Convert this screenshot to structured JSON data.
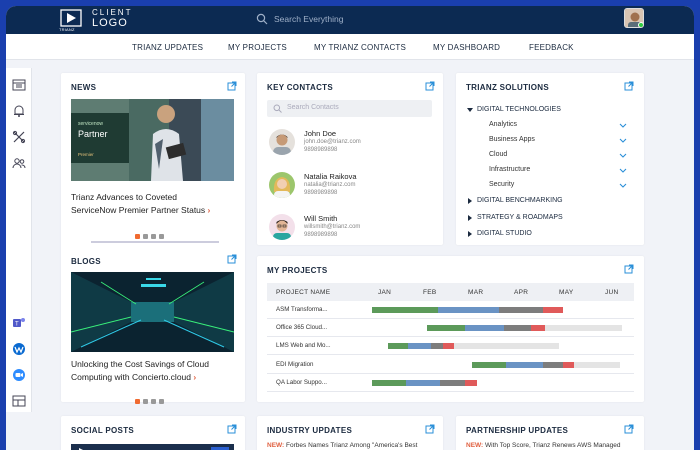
{
  "header": {
    "logo_text_1": "CLIENT",
    "logo_text_2": "LOGO",
    "logo_sub": "TRIANZ",
    "search_placeholder": "Search Everything"
  },
  "nav": {
    "items": [
      "TRIANZ UPDATES",
      "MY PROJECTS",
      "MY TRIANZ CONTACTS",
      "MY DASHBOARD",
      "FEEDBACK"
    ]
  },
  "news": {
    "title": "NEWS",
    "image_badge_brand": "servicenow",
    "image_badge_title": "Partner",
    "image_badge_tier": "Premier",
    "article_line1": "Trianz Advances to Coveted",
    "article_line2": "ServiceNow Premier Partner Status",
    "arrow": "›"
  },
  "blogs": {
    "title": "BLOGS",
    "article_line1": "Unlocking the Cost Savings of Cloud",
    "article_line2": "Computing with Concierto.cloud",
    "arrow": "›"
  },
  "contacts": {
    "title": "KEY CONTACTS",
    "search_placeholder": "Search Contacts",
    "people": [
      {
        "name": "John Doe",
        "email": "john.doe@trianz.com",
        "phone": "9898989898"
      },
      {
        "name": "Natalia Raikova",
        "email": "natalia@trianz.com",
        "phone": "9898989898"
      },
      {
        "name": "Will Smith",
        "email": "willsmith@trianz.com",
        "phone": "9898989898"
      }
    ]
  },
  "solutions": {
    "title": "TRIANZ SOLUTIONS",
    "digital_technologies": "DIGITAL TECHNOLOGIES",
    "sub_items": [
      "Analytics",
      "Business Apps",
      "Cloud",
      "Infrastructure",
      "Security"
    ],
    "digital_benchmarking": "DIGITAL BENCHMARKING",
    "strategy": "STRATEGY & ROADMAPS",
    "digital_studio": "DIGITAL STUDIO"
  },
  "projects": {
    "title": "MY PROJECTS",
    "column_header": "PROJECT NAME",
    "months": [
      "JAN",
      "FEB",
      "MAR",
      "APR",
      "MAY",
      "JUN"
    ],
    "rows": [
      {
        "name": "ASM Transforma...",
        "segments": [
          {
            "from": 0.0,
            "to": 1.45,
            "color": "#5c9a5a"
          },
          {
            "from": 1.45,
            "to": 2.8,
            "color": "#6a93c4"
          },
          {
            "from": 2.8,
            "to": 3.75,
            "color": "#7d7d7d"
          },
          {
            "from": 3.75,
            "to": 4.2,
            "color": "#e05a5a"
          }
        ]
      },
      {
        "name": "Office 365 Cloud...",
        "segments": [
          {
            "from": 1.2,
            "to": 2.05,
            "color": "#5c9a5a"
          },
          {
            "from": 2.05,
            "to": 2.9,
            "color": "#6a93c4"
          },
          {
            "from": 2.9,
            "to": 3.5,
            "color": "#7d7d7d"
          },
          {
            "from": 3.5,
            "to": 3.8,
            "color": "#e05a5a"
          },
          {
            "from": 3.8,
            "to": 5.5,
            "color": "#e4e4e4"
          }
        ]
      },
      {
        "name": "LMS Web and Mo...",
        "segments": [
          {
            "from": 0.35,
            "to": 0.8,
            "color": "#5c9a5a"
          },
          {
            "from": 0.8,
            "to": 1.3,
            "color": "#6a93c4"
          },
          {
            "from": 1.3,
            "to": 1.55,
            "color": "#7d7d7d"
          },
          {
            "from": 1.55,
            "to": 1.8,
            "color": "#e05a5a"
          },
          {
            "from": 1.8,
            "to": 4.1,
            "color": "#e4e4e4"
          }
        ]
      },
      {
        "name": "EDI Migration",
        "segments": [
          {
            "from": 2.2,
            "to": 2.95,
            "color": "#5c9a5a"
          },
          {
            "from": 2.95,
            "to": 3.75,
            "color": "#6a93c4"
          },
          {
            "from": 3.75,
            "to": 4.2,
            "color": "#7d7d7d"
          },
          {
            "from": 4.2,
            "to": 4.45,
            "color": "#e05a5a"
          },
          {
            "from": 4.45,
            "to": 5.45,
            "color": "#e4e4e4"
          }
        ]
      },
      {
        "name": "QA Labor Suppo...",
        "segments": [
          {
            "from": 0.0,
            "to": 0.75,
            "color": "#5c9a5a"
          },
          {
            "from": 0.75,
            "to": 1.5,
            "color": "#6a93c4"
          },
          {
            "from": 1.5,
            "to": 2.05,
            "color": "#7d7d7d"
          },
          {
            "from": 2.05,
            "to": 2.3,
            "color": "#e05a5a"
          }
        ]
      }
    ]
  },
  "social": {
    "title": "SOCIAL POSTS"
  },
  "industry": {
    "title": "INDUSTRY UPDATES",
    "new_tag": "NEW:",
    "headline": "Forbes Names Trianz Among \"America's Best"
  },
  "partnership": {
    "title": "PARTNERSHIP UPDATES",
    "new_tag": "NEW:",
    "headline": "With Top Score, Trianz Renews AWS Managed"
  },
  "colors": {
    "header_bg": "#0c2a52",
    "frame_bg": "#1a3fae",
    "accent": "#2a8fd8",
    "alert": "#e06040"
  }
}
